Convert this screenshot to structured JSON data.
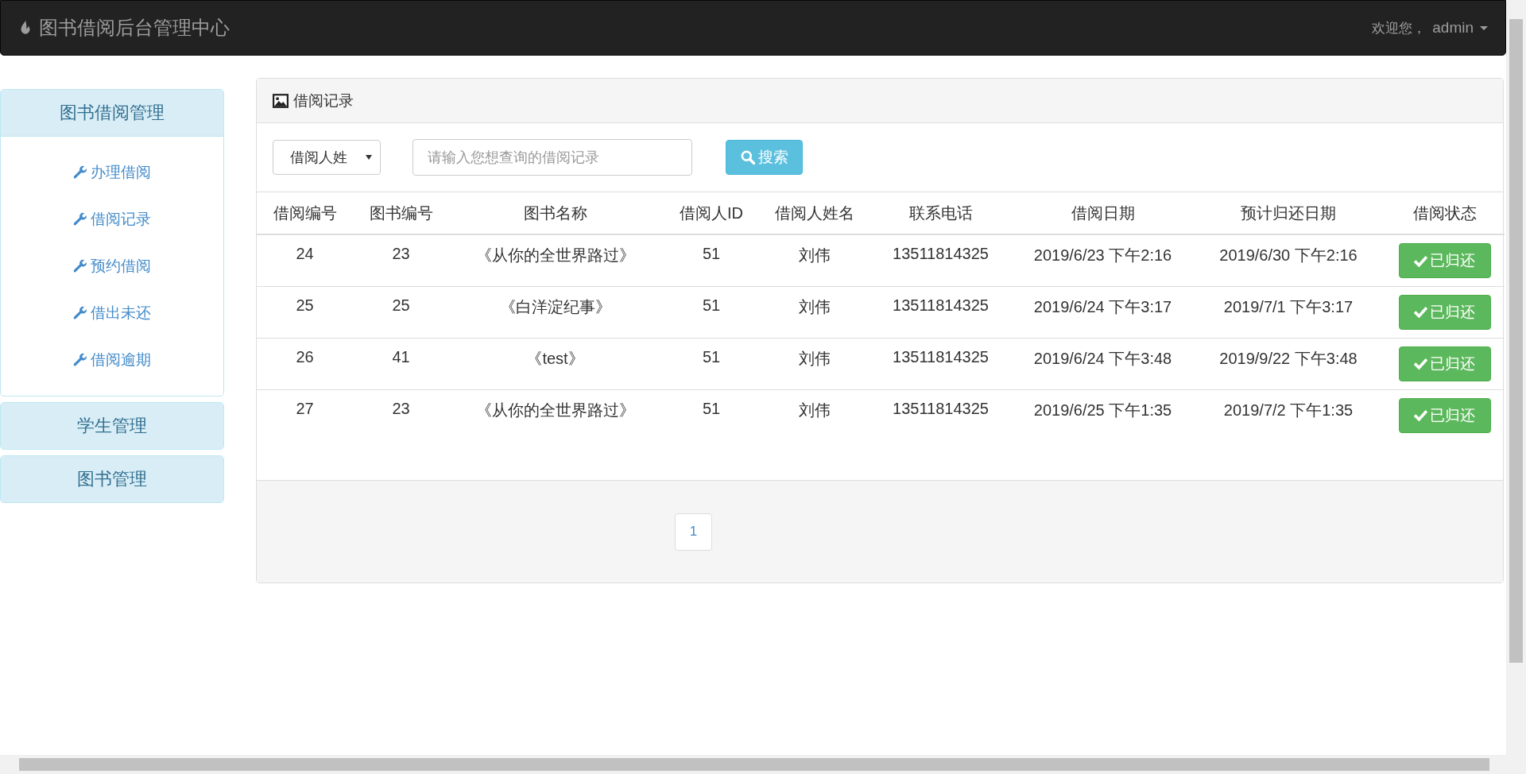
{
  "navbar": {
    "brand": "图书借阅后台管理中心",
    "greeting": "欢迎您，",
    "user": "admin"
  },
  "sidebar": {
    "groups": [
      {
        "title": "图书借阅管理",
        "expanded": true,
        "items": [
          "办理借阅",
          "借阅记录",
          "预约借阅",
          "借出未还",
          "借阅逾期"
        ]
      },
      {
        "title": "学生管理",
        "expanded": false
      },
      {
        "title": "图书管理",
        "expanded": false
      }
    ]
  },
  "panel": {
    "title": "借阅记录",
    "search": {
      "field_select": "借阅人姓",
      "placeholder": "请输入您想查询的借阅记录",
      "button": "搜索"
    },
    "table": {
      "columns": [
        "借阅编号",
        "图书编号",
        "图书名称",
        "借阅人ID",
        "借阅人姓名",
        "联系电话",
        "借阅日期",
        "预计归还日期",
        "借阅状态"
      ],
      "rows": [
        {
          "cells": [
            "24",
            "23",
            "《从你的全世界路过》",
            "51",
            "刘伟",
            "13511814325",
            "2019/6/23 下午2:16",
            "2019/6/30 下午2:16"
          ],
          "status": {
            "kind": "returned",
            "label": "已归还"
          }
        },
        {
          "cells": [
            "25",
            "25",
            "《白洋淀纪事》",
            "51",
            "刘伟",
            "13511814325",
            "2019/6/24 下午3:17",
            "2019/7/1 下午3:17"
          ],
          "status": {
            "kind": "returned",
            "label": "已归还"
          }
        },
        {
          "cells": [
            "26",
            "41",
            "《test》",
            "51",
            "刘伟",
            "13511814325",
            "2019/6/24 下午3:48",
            "2019/9/22 下午3:48"
          ],
          "status": {
            "kind": "returned",
            "label": "已归还"
          }
        },
        {
          "cells": [
            "27",
            "23",
            "《从你的全世界路过》",
            "51",
            "刘伟",
            "13511814325",
            "2019/6/25 下午1:35",
            "2019/7/2 下午1:35"
          ],
          "status": {
            "kind": "returned",
            "label": "已归还"
          }
        }
      ]
    },
    "pagination": [
      {
        "label": "1",
        "selected": true
      }
    ]
  }
}
